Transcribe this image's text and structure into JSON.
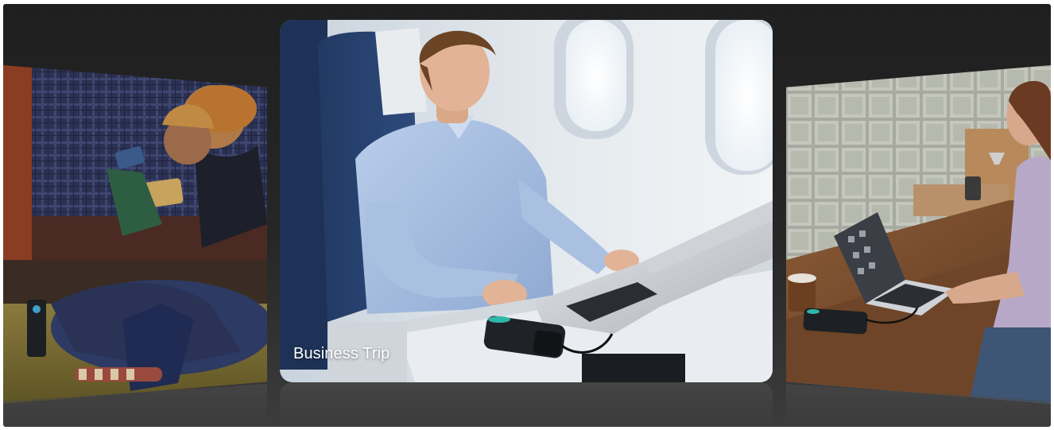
{
  "carousel": {
    "slides": [
      {
        "id": "slide-left",
        "caption": ""
      },
      {
        "id": "slide-center",
        "caption": "Business Trip",
        "active": true
      },
      {
        "id": "slide-right",
        "caption": ""
      }
    ]
  },
  "colors": {
    "stage_background": "#222222",
    "caption_text": "#ffffff"
  }
}
